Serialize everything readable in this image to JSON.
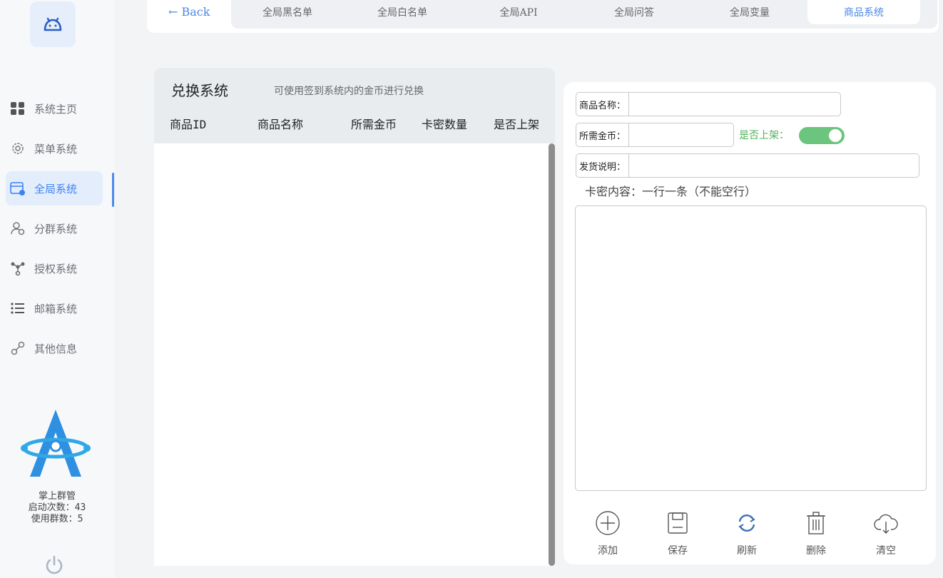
{
  "sidebar": {
    "items": [
      {
        "label": "系统主页",
        "icon": "grid-icon"
      },
      {
        "label": "菜单系统",
        "icon": "gear-icon"
      },
      {
        "label": "全局系统",
        "icon": "window-settings-icon"
      },
      {
        "label": "分群系统",
        "icon": "user-group-icon"
      },
      {
        "label": "授权系统",
        "icon": "network-icon"
      },
      {
        "label": "邮箱系统",
        "icon": "list-icon"
      },
      {
        "label": "其他信息",
        "icon": "link-icon"
      }
    ],
    "active_index": 2,
    "brand_name": "掌上群管",
    "launch_count": "启动次数：43",
    "group_count": "使用群数：5"
  },
  "topbar": {
    "back_label": "← Back",
    "tabs": [
      "全局黑名单",
      "全局白名单",
      "全局API",
      "全局问答",
      "全局变量",
      "商品系统"
    ],
    "active_tab": 5
  },
  "table": {
    "title": "兑换系统",
    "subtitle": "可使用签到系统内的金币进行兑换",
    "columns": [
      "商品ID",
      "商品名称",
      "所需金币",
      "卡密数量",
      "是否上架"
    ],
    "rows": []
  },
  "form": {
    "name_label": "商品名称：",
    "name_value": "",
    "coins_label": "所需金币：",
    "coins_value": "",
    "publish_label": "是否上架：",
    "publish_on": true,
    "desc_label": "发货说明：",
    "desc_value": "",
    "card_label": "卡密内容：一行一条（不能空行）",
    "card_value": ""
  },
  "actions": [
    {
      "label": "添加",
      "icon": "add-circle-icon"
    },
    {
      "label": "保存",
      "icon": "save-icon"
    },
    {
      "label": "刷新",
      "icon": "refresh-icon"
    },
    {
      "label": "删除",
      "icon": "trash-icon"
    },
    {
      "label": "清空",
      "icon": "cloud-clear-icon"
    }
  ],
  "colors": {
    "accent": "#4a86e8",
    "toggle_on": "#6cc57c",
    "publish_text": "#4cb35a",
    "brand_blue": "#2f8fe0"
  }
}
